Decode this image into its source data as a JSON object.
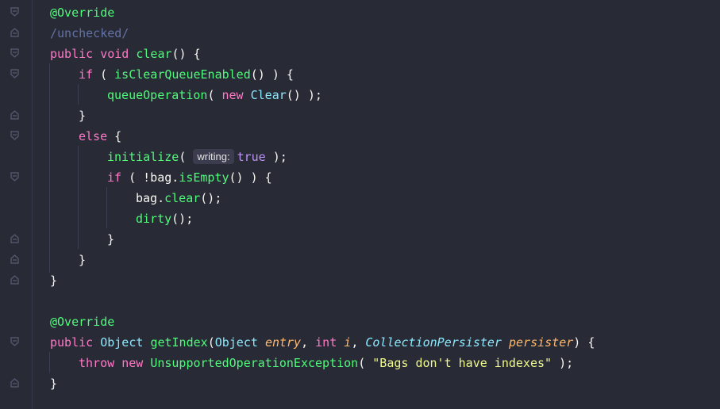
{
  "code": {
    "l1": {
      "annotation": "@Override"
    },
    "l2": {
      "comment": "/unchecked/"
    },
    "l3": {
      "kw_public": "public",
      "kw_void": "void",
      "method": "clear",
      "rest": "() {"
    },
    "l4": {
      "kw_if": "if",
      "open": " ( ",
      "call": "isClearQueueEnabled",
      "rest": "() ) {"
    },
    "l5": {
      "call": "queueOperation",
      "open": "( ",
      "kw_new": "new",
      "cls": "Clear",
      "rest": "() );"
    },
    "l6": {
      "text": "}"
    },
    "l7": {
      "kw_else": "else",
      "rest": " {"
    },
    "l8": {
      "call": "initialize",
      "open": "( ",
      "hint": "writing:",
      "bool": "true",
      "rest": " );"
    },
    "l9": {
      "kw_if": "if",
      "open": " ( !bag.",
      "call": "isEmpty",
      "rest": "() ) {"
    },
    "l10": {
      "obj": "bag.",
      "call": "clear",
      "rest": "();"
    },
    "l11": {
      "call": "dirty",
      "rest": "();"
    },
    "l12": {
      "text": "}"
    },
    "l13": {
      "text": "}"
    },
    "l14": {
      "text": "}"
    },
    "l15": {
      "annotation": "@Override"
    },
    "l16": {
      "kw_public": "public",
      "ret_type": "Object",
      "method": "getIndex",
      "p1_type": "Object",
      "p1_name": "entry",
      "p2_type": "int",
      "p2_name": "i",
      "p3_type": "CollectionPersister",
      "p3_name": "persister",
      "rest": ") {"
    },
    "l17": {
      "kw_throw": "throw",
      "kw_new": "new",
      "cls": "UnsupportedOperationException",
      "open": "( ",
      "str": "\"Bags don't have indexes\"",
      "rest": " );"
    },
    "l18": {
      "text": "}"
    }
  },
  "colors": {
    "background": "#282a36",
    "keyword": "#ff79c6",
    "annotation": "#50fa7b",
    "comment": "#6272a4",
    "method": "#50fa7b",
    "class": "#8be9fd",
    "string": "#f1fa8c",
    "boolean": "#bd93f9",
    "parameter": "#ffb86c"
  },
  "gutter_icons": [
    "fold-icon"
  ]
}
